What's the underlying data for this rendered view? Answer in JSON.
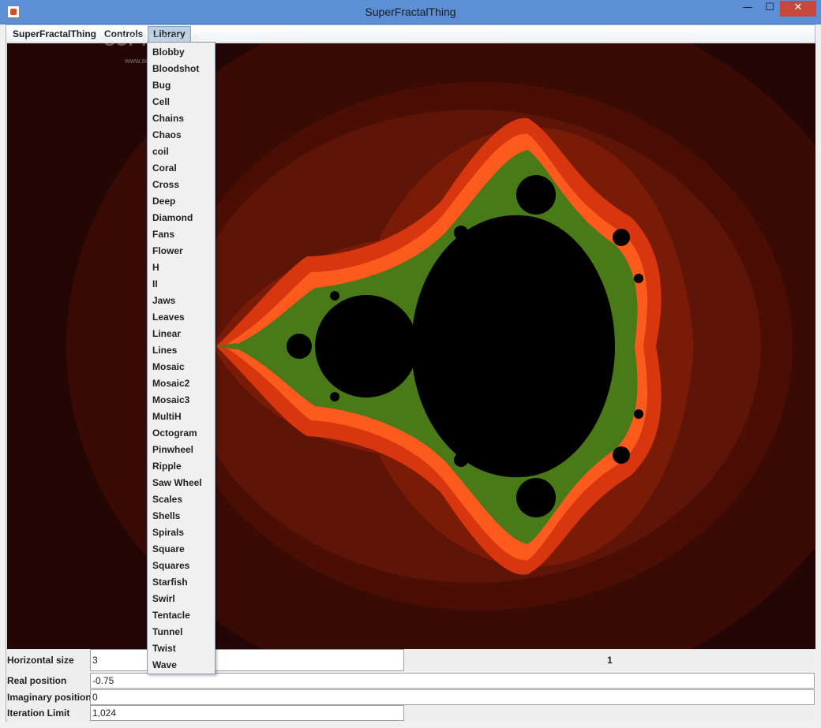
{
  "window": {
    "title": "SuperFractalThing",
    "minimize": "—",
    "maximize": "☐",
    "close": "✕"
  },
  "menubar": {
    "items": [
      "SuperFractalThing",
      "Controls",
      "Library"
    ]
  },
  "watermark": {
    "text": "SOFTPEDIA",
    "url": "www.softpedia.com"
  },
  "library_menu": {
    "items": [
      "Blobby",
      "Bloodshot",
      "Bug",
      "Cell",
      "Chains",
      "Chaos",
      "coil",
      "Coral",
      "Cross",
      "Deep",
      "Diamond",
      "Fans",
      "Flower",
      "H",
      "II",
      "Jaws",
      "Leaves",
      "Linear",
      "Lines",
      "Mosaic",
      "Mosaic2",
      "Mosaic3",
      "MultiH",
      "Octogram",
      "Pinwheel",
      "Ripple",
      "Saw Wheel",
      "Scales",
      "Shells",
      "Spirals",
      "Square",
      "Squares",
      "Starfish",
      "Swirl",
      "Tentacle",
      "Tunnel",
      "Twist",
      "Wave"
    ]
  },
  "controls": {
    "horizontal_size_label": "Horizontal size",
    "horizontal_size_value": "3",
    "iteration_count": "1",
    "real_position_label": "Real position",
    "real_position_value": "-0.75",
    "imaginary_position_label": "Imaginary position",
    "imaginary_position_value": "0",
    "iteration_limit_label": "Iteration Limit",
    "iteration_limit_value": "1,024"
  },
  "colors": {
    "background_outer": "#250606",
    "band_dark": "#3d0a04",
    "band_mid": "#5a1407",
    "band_red": "#8a1e08",
    "band_bright": "#e03a10",
    "band_orange": "#ff5a1e",
    "set": "#000000"
  }
}
